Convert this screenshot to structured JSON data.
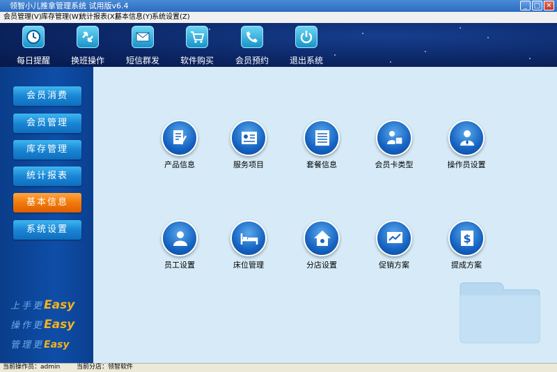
{
  "window": {
    "title": "领智小儿推拿管理系统 试用版v6.4",
    "min_label": "_",
    "max_label": "□",
    "close_label": "✕"
  },
  "menu": [
    "会员管理(V)",
    "库存管理(W)",
    "统计报表(X)",
    "基本信息(Y)",
    "系统设置(Z)"
  ],
  "toolbar": [
    {
      "label": "每日提醒",
      "icon": "clock-icon"
    },
    {
      "label": "换班操作",
      "icon": "swap-arrows-icon"
    },
    {
      "label": "短信群发",
      "icon": "envelope-icon"
    },
    {
      "label": "软件购买",
      "icon": "shopping-cart-icon"
    },
    {
      "label": "会员预约",
      "icon": "phone-icon"
    },
    {
      "label": "退出系统",
      "icon": "power-icon"
    }
  ],
  "sidebar": {
    "items": [
      {
        "label": "会员消费",
        "active": false
      },
      {
        "label": "会员管理",
        "active": false
      },
      {
        "label": "库存管理",
        "active": false
      },
      {
        "label": "统计报表",
        "active": false
      },
      {
        "label": "基本信息",
        "active": true
      },
      {
        "label": "系统设置",
        "active": false
      }
    ],
    "slogans": [
      {
        "cn": "上手更",
        "en": "Easy"
      },
      {
        "cn": "操作更",
        "en": "Easy"
      },
      {
        "cn": "管理更",
        "en": "Easy"
      }
    ]
  },
  "modules": [
    {
      "label": "产品信息",
      "icon": "document-pen-icon"
    },
    {
      "label": "服务项目",
      "icon": "profile-card-icon"
    },
    {
      "label": "套餐信息",
      "icon": "list-document-icon"
    },
    {
      "label": "会员卡类型",
      "icon": "member-card-icon"
    },
    {
      "label": "操作员设置",
      "icon": "operator-tie-icon"
    },
    {
      "label": "员工设置",
      "icon": "person-icon"
    },
    {
      "label": "床位管理",
      "icon": "bed-icon"
    },
    {
      "label": "分店设置",
      "icon": "house-gear-icon"
    },
    {
      "label": "促销方案",
      "icon": "chart-board-icon"
    },
    {
      "label": "提成方案",
      "icon": "dollar-document-icon"
    }
  ],
  "status": {
    "operator": "当前操作员：admin",
    "branch": "当前分店：领智软件"
  },
  "colors": {
    "accent": "#1a86d4",
    "active": "#f07a0c",
    "toolbar_bg": "#0c2766",
    "main_bg": "#d6ebf7"
  }
}
